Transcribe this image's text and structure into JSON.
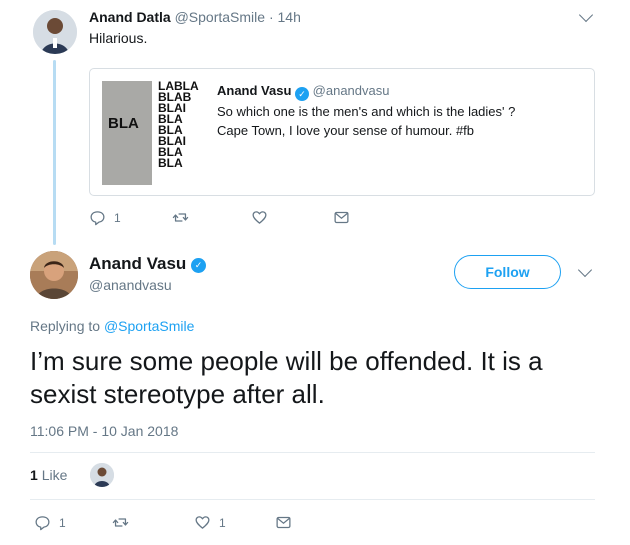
{
  "parent_tweet": {
    "name": "Anand Datla",
    "handle": "@SportaSmile",
    "separator": "·",
    "time": "14h",
    "text": "Hilarious."
  },
  "quoted_tweet": {
    "image_texts": {
      "bla": "BLA",
      "stack": [
        "LABLA",
        "BLAB",
        "BLAI",
        "BLA",
        "BLA",
        "BLAI",
        "BLA",
        "BLA"
      ],
      "vertical": "BLA BLA BLA"
    },
    "name": "Anand Vasu",
    "handle": "@anandvasu",
    "text_line1": "So which one is the men's and which is the ladies' ?",
    "text_line2": "Cape Town, I love your sense of humour. #fb"
  },
  "parent_actions": {
    "reply_count": "1"
  },
  "main_tweet": {
    "name": "Anand Vasu",
    "handle": "@anandvasu",
    "follow_label": "Follow",
    "replying_prefix": "Replying to",
    "replying_to": "@SportaSmile",
    "text": "I’m sure some people will be offended. It is a sexist stereotype after all.",
    "timestamp": "11:06 PM - 10 Jan 2018",
    "likes_count": "1",
    "likes_label": "Like"
  },
  "main_actions": {
    "reply_count": "1",
    "like_count": "1"
  },
  "colors": {
    "accent": "#1da1f2",
    "muted": "#657786",
    "thread_line": "#b7dcf3"
  },
  "icons": [
    "reply-icon",
    "retweet-icon",
    "heart-icon",
    "mail-icon",
    "chevron-down-icon",
    "verified-icon"
  ]
}
